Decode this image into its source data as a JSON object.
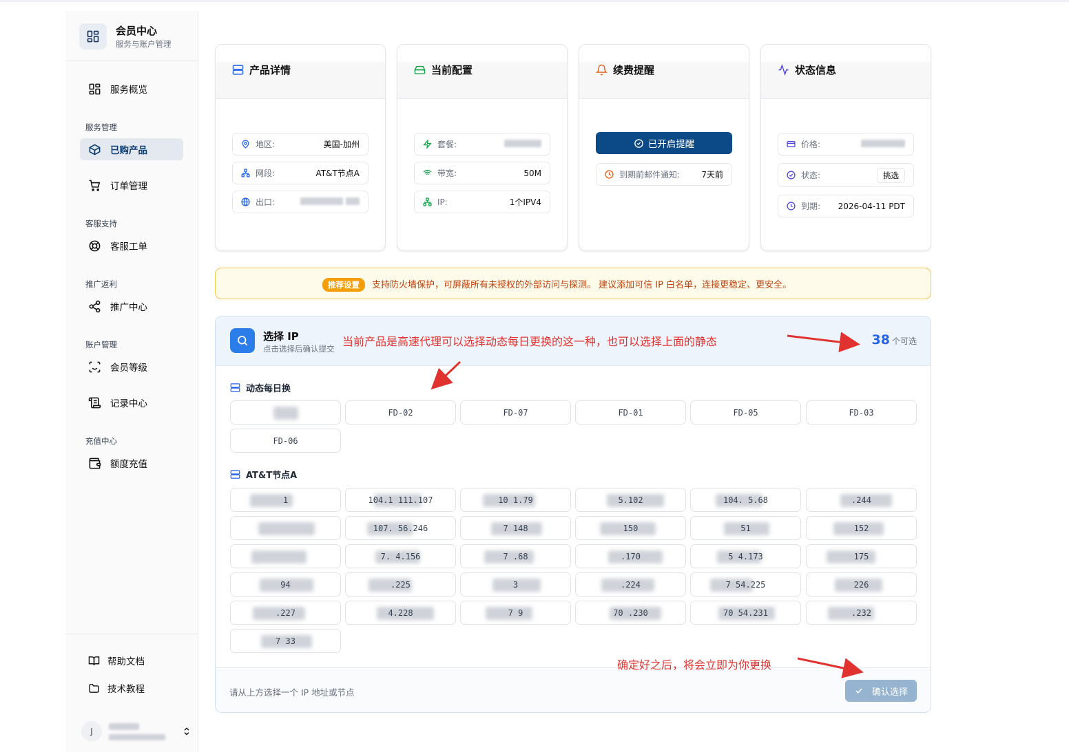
{
  "sidebar": {
    "brand_title": "会员中心",
    "brand_subtitle": "服务与账户管理",
    "overview": "服务概览",
    "sections": {
      "service": "服务管理",
      "support": "客服支持",
      "promo": "推广返利",
      "account": "账户管理",
      "recharge": "充值中心"
    },
    "items": {
      "purchased": "已购产品",
      "orders": "订单管理",
      "tickets": "客服工单",
      "promo_center": "推广中心",
      "member_level": "会员等级",
      "records": "记录中心",
      "recharge": "额度充值"
    },
    "footer": {
      "help": "帮助文档",
      "tutorial": "技术教程"
    },
    "user_initial": "J"
  },
  "cards": {
    "product": {
      "title": "产品详情",
      "region_label": "地区:",
      "region_value": "美国-加州",
      "segment_label": "网段:",
      "segment_value": "AT&T节点A",
      "egress_label": "出口:"
    },
    "config": {
      "title": "当前配置",
      "plan_label": "套餐:",
      "bandwidth_label": "带宽:",
      "bandwidth_value": "50M",
      "ip_label": "IP:",
      "ip_value": "1个IPV4"
    },
    "renewal": {
      "title": "续费提醒",
      "button": "已开启提醒",
      "notice_label": "到期前邮件通知:",
      "notice_value": "7天前"
    },
    "status": {
      "title": "状态信息",
      "price_label": "价格:",
      "status_label": "状态:",
      "status_value": "挑选",
      "expire_label": "到期:",
      "expire_value": "2026-04-11 PDT"
    }
  },
  "notice": {
    "tag": "推荐设置",
    "text": "支持防火墙保护，可屏蔽所有未授权的外部访问与探测。 建议添加可信 IP 白名单，连接更稳定、更安全。"
  },
  "ip_panel": {
    "title": "选择 IP",
    "subtitle": "点击选择后确认提交",
    "count": "38",
    "count_suffix": "个可选",
    "group1_title": "动态每日换",
    "group1": [
      "",
      "FD-02",
      "FD-07",
      "FD-01",
      "FD-05",
      "FD-03",
      "FD-06"
    ],
    "group2_title": "AT&T节点A",
    "group2": [
      "1",
      "104.1  111.107",
      "10        1.79",
      "        5.102",
      "104.     5.68",
      "      .244",
      "",
      "107.    56.246",
      "7        148",
      "        150",
      "         51",
      "        152",
      "",
      "7.     4.156",
      "7        .68",
      "        .170",
      "5     4.173",
      "      175",
      "        94",
      "      .225",
      "         3",
      "        .224",
      "7      54.225",
      "        226",
      "        .227",
      "      4.228",
      "7          9",
      "70       .230",
      "70     54.231",
      "        .232",
      "7       33"
    ],
    "footer_hint": "请从上方选择一个 IP 地址或节点",
    "confirm": "确认选择"
  },
  "annotations": {
    "top": "当前产品是高速代理可以选择动态每日更换的这一种，也可以选择上面的静态",
    "bottom": "确定好之后，将会立即为你更换"
  },
  "colors": {
    "primary": "#0b4a86",
    "accent_blue": "#2563eb",
    "notice_orange": "#f59e0b",
    "annotation_red": "#e0332f"
  }
}
